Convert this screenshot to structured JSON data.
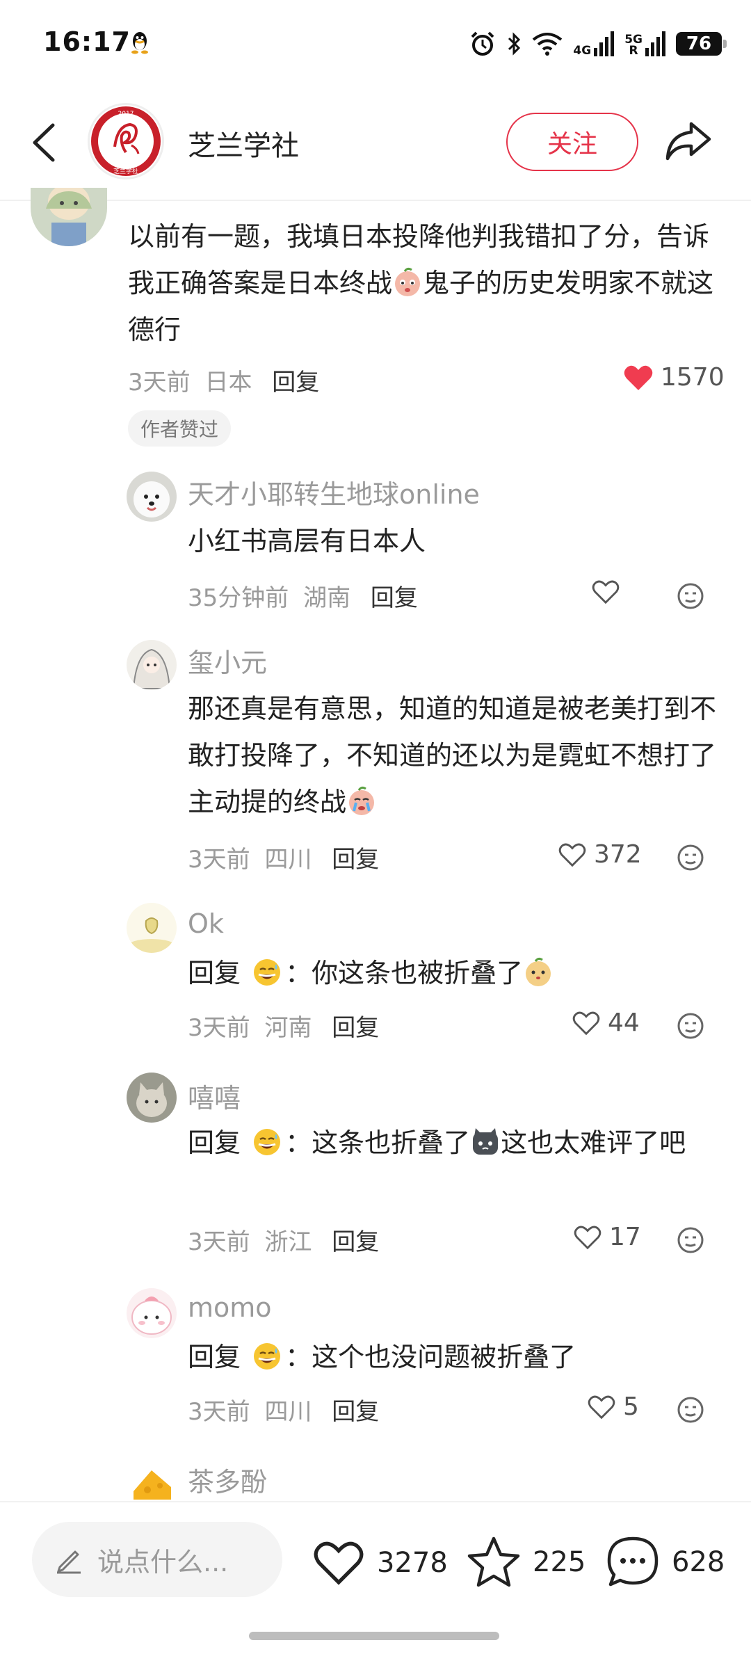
{
  "status_bar": {
    "time": "16:17",
    "network_1": "4G",
    "network_2": "5G",
    "network_2_sub": "R",
    "battery": "76"
  },
  "header": {
    "title": "芝兰学社",
    "follow_label": "关注",
    "avatar_year": "2017",
    "avatar_text": "芝兰学社"
  },
  "main_comment": {
    "text_part1": "以前有一题，我填日本投降他判我错扣了分，告诉我正确答案是日本终战",
    "text_part2": "鬼子的历史发明家不就这德行",
    "time": "3天前",
    "location": "日本",
    "reply_label": "回复",
    "likes": "1570",
    "author_badge": "作者赞过"
  },
  "replies": [
    {
      "name": "天才小耶转生地球online",
      "text": "小红书高层有日本人",
      "time": "35分钟前",
      "location": "湖南",
      "reply_label": "回复",
      "likes": ""
    },
    {
      "name": "玺小元",
      "text": "那还真是有意思，知道的知道是被老美打到不敢打投降了，不知道的还以为是霓虹不想打了主动提的终战",
      "time": "3天前",
      "location": "四川",
      "reply_label": "回复",
      "likes": "372"
    },
    {
      "name": "Ok",
      "prefix": "回复",
      "suffix": "：你这条也被折叠了",
      "time": "3天前",
      "location": "河南",
      "reply_label": "回复",
      "likes": "44"
    },
    {
      "name": "嘻嘻",
      "prefix": "回复",
      "suffix": "：这条也折叠了",
      "suffix2": "这也太难评了吧",
      "time": "3天前",
      "location": "浙江",
      "reply_label": "回复",
      "likes": "17"
    },
    {
      "name": "momo",
      "prefix": "回复",
      "suffix": "：这个也没问题被折叠了",
      "time": "3天前",
      "location": "四川",
      "reply_label": "回复",
      "likes": "5"
    },
    {
      "name": "茶多酚"
    }
  ],
  "bottom_bar": {
    "input_placeholder": "说点什么...",
    "likes": "3278",
    "favorites": "225",
    "comments": "628"
  },
  "colors": {
    "accent": "#e5344a",
    "like_red": "#f03c50",
    "muted_text": "#9a9a9a"
  },
  "icons": [
    "back-icon",
    "share-icon",
    "heart-icon",
    "heart-outline-icon",
    "emoji-face-icon",
    "star-icon",
    "chat-bubble-icon",
    "pencil-icon"
  ]
}
